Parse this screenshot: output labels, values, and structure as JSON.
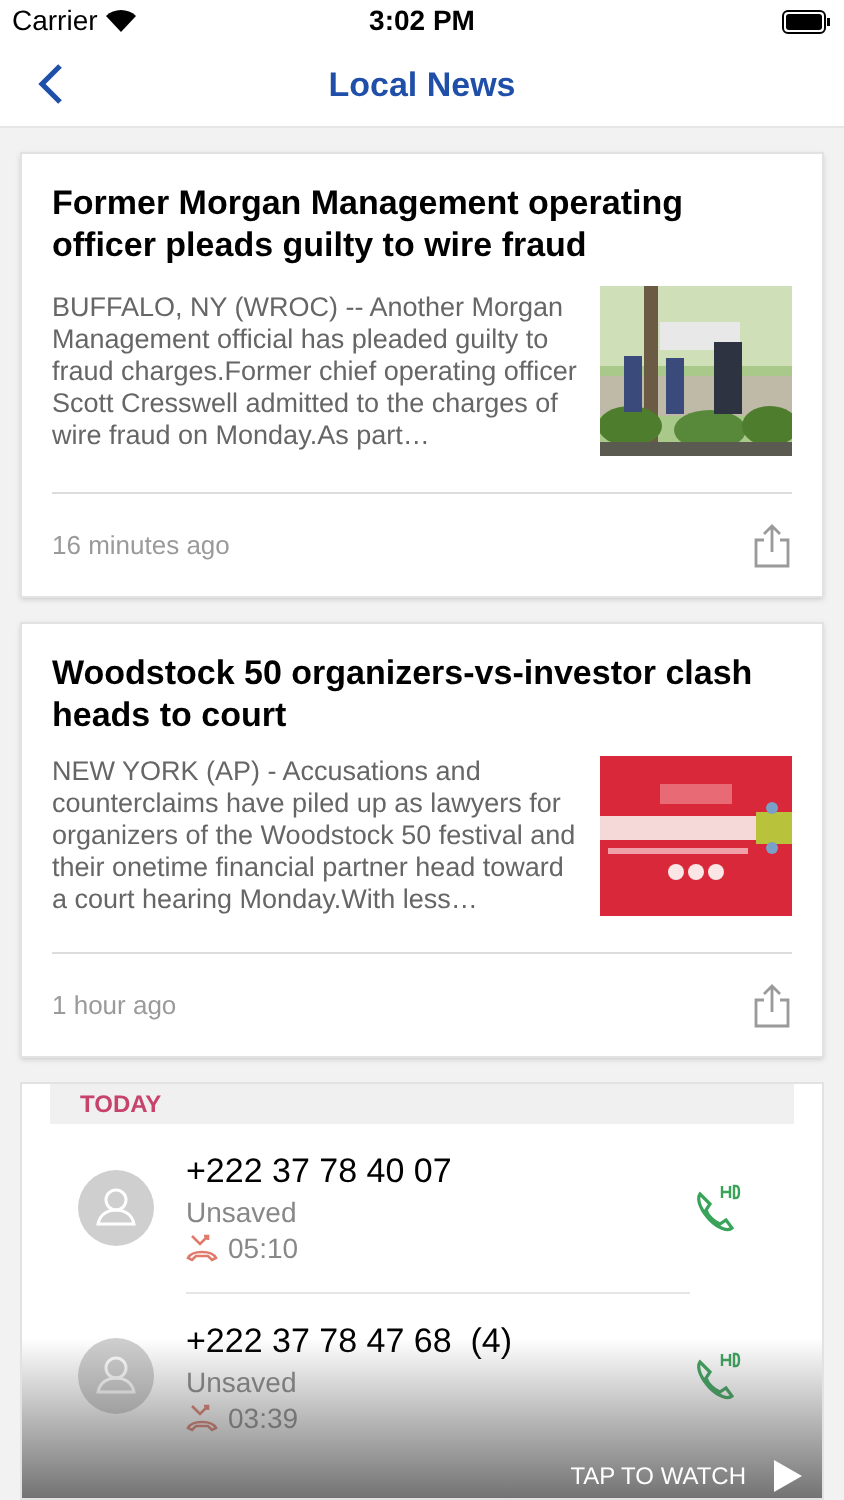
{
  "status_bar": {
    "carrier": "Carrier",
    "time": "3:02 PM"
  },
  "nav": {
    "title": "Local News"
  },
  "articles": [
    {
      "kind": "story",
      "headline": "Former Morgan Management operating officer pleads guilty to wire fraud",
      "summary": "BUFFALO, NY (WROC) -- Another Morgan Management official has pleaded guilty to fraud charges.Former chief operating officer Scott Cresswell admitted to the charges of wire fraud on Monday.As part…",
      "time": "16 minutes ago"
    },
    {
      "kind": "story",
      "headline": "Woodstock 50 organizers-vs-investor clash heads to court",
      "summary": "NEW YORK (AP) - Accusations and counterclaims have piled up as lawyers for organizers of the Woodstock 50 festival and their onetime financial partner head toward a court hearing Monday.With less…",
      "time": "1 hour ago"
    }
  ],
  "video_ad": {
    "section": "TODAY",
    "calls": [
      {
        "number": "+222 37 78 40 07",
        "label": "Unsaved",
        "duration": "05:10"
      },
      {
        "number": "+222 37 78 47 68  (4)",
        "label": "Unsaved",
        "duration": "03:39"
      }
    ],
    "cta": "TAP TO WATCH"
  }
}
